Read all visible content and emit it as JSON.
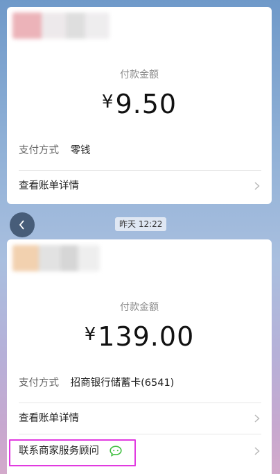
{
  "payments": [
    {
      "amount_label": "付款金额",
      "currency": "¥",
      "amount": "9.50",
      "method_label": "支付方式",
      "method_value": "零钱",
      "details_link": "查看账单详情"
    },
    {
      "amount_label": "付款金额",
      "currency": "¥",
      "amount": "139.00",
      "method_label": "支付方式",
      "method_value": "招商银行储蓄卡(6541)",
      "details_link": "查看账单详情",
      "contact_link": "联系商家服务顾问"
    }
  ],
  "timestamp": "昨天 12:22",
  "colors": {
    "highlight_border": "#e13ae0",
    "chat_icon": "#3fbf3f"
  }
}
